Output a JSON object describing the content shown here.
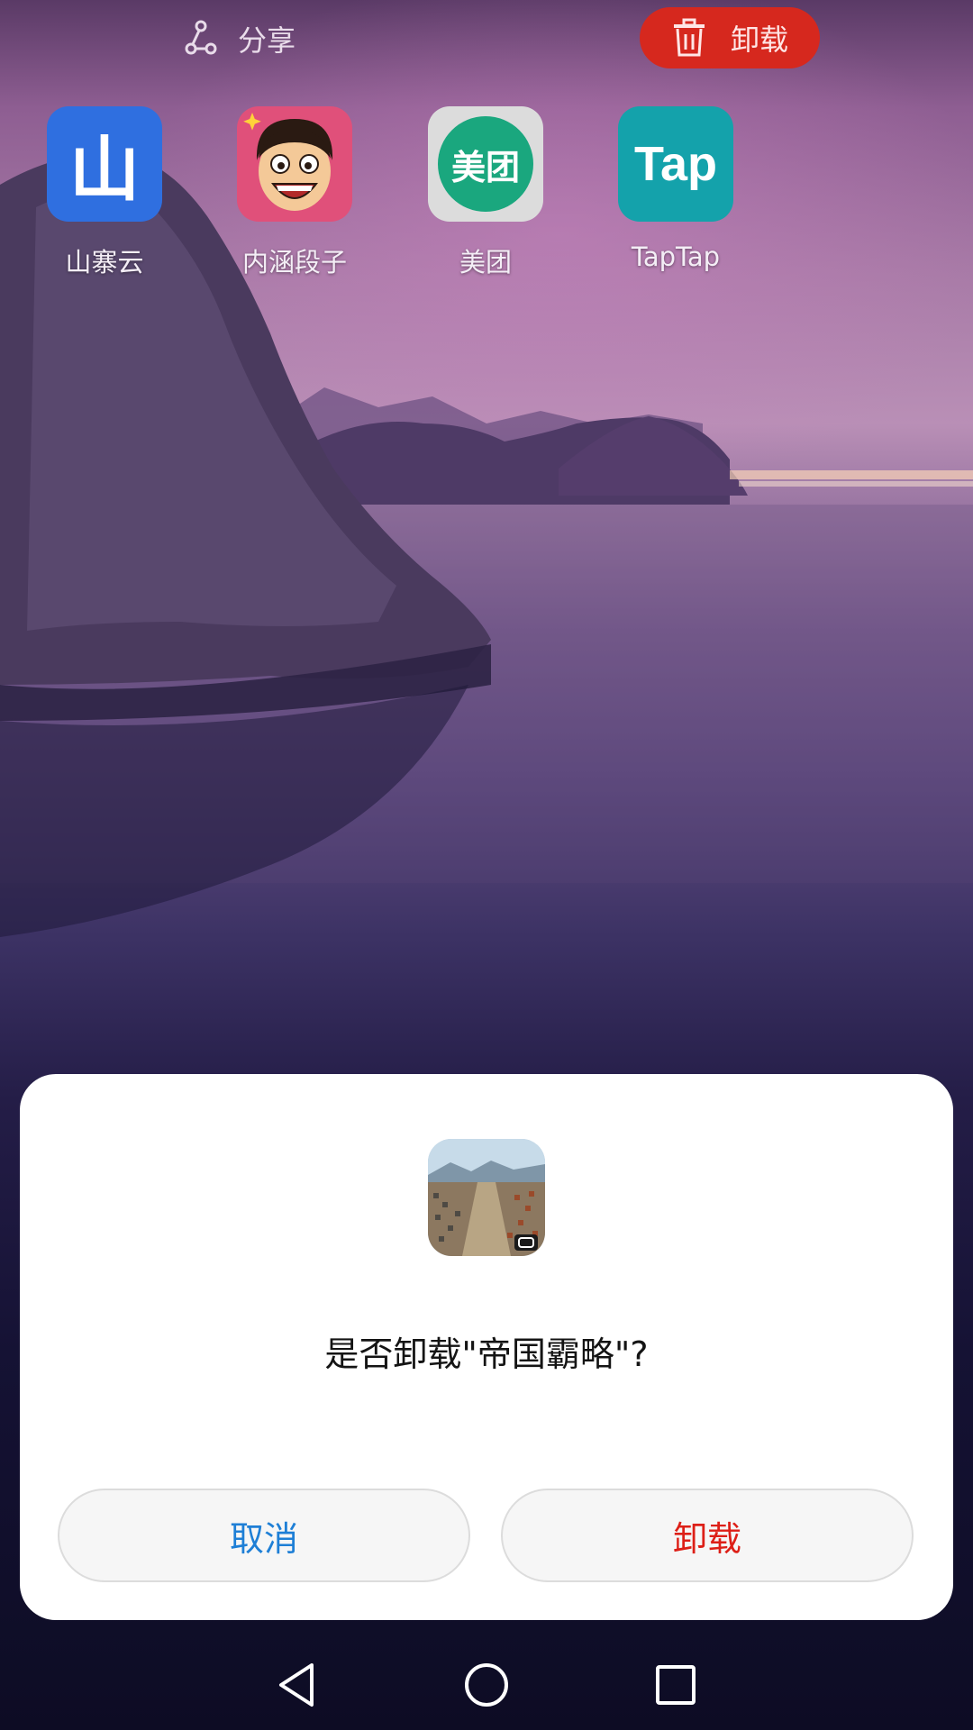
{
  "top_bar": {
    "share_label": "分享",
    "uninstall_label": "卸载",
    "uninstall_color": "#d6281e"
  },
  "apps": [
    {
      "label": "山寨云",
      "icon_text": "山",
      "icon": "shanzhaiyun-icon",
      "color": "#2f6fe0"
    },
    {
      "label": "内涵段子",
      "icon": "neihan-duanzi-face-icon",
      "color": "#e0507a"
    },
    {
      "label": "美团",
      "icon_text": "美团",
      "icon": "meituan-icon",
      "color": "#1aa77e"
    },
    {
      "label": "TapTap",
      "icon_text": "Tap",
      "icon": "taptap-icon",
      "color": "#14a2ab"
    }
  ],
  "dialog": {
    "app_icon": "empire-game-icon",
    "message": "是否卸载\"帝国霸略\"?",
    "cancel_label": "取消",
    "confirm_label": "卸载",
    "cancel_color": "#1e7fd6",
    "confirm_color": "#dd1f17"
  },
  "navbar": {
    "back": "back-triangle-icon",
    "home": "home-circle-icon",
    "recents": "recents-square-icon"
  }
}
